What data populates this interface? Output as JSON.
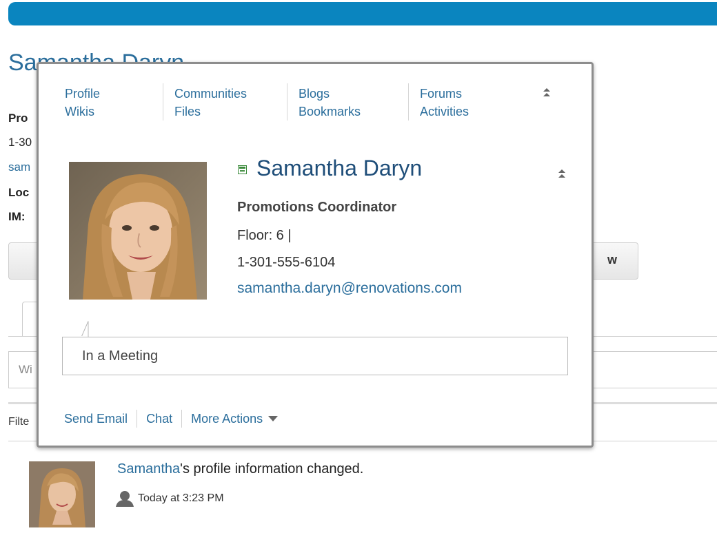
{
  "background": {
    "name_heading": "Samantha Daryn",
    "contact_lines": [
      {
        "text": "Pro",
        "style": "bold"
      },
      {
        "text": "1-30",
        "style": "plain"
      },
      {
        "text": "sam",
        "style": "link"
      },
      {
        "text": "Loc",
        "style": "bold"
      },
      {
        "text": "IM:",
        "style": "bold"
      }
    ],
    "button_fragment": "w",
    "status_input_placeholder": "Wi",
    "filter_label": "Filte",
    "activity": {
      "user_link": "Samantha",
      "message": "'s profile information changed.",
      "timestamp": "Today at 3:23 PM"
    }
  },
  "card": {
    "nav_columns": [
      [
        "Profile",
        "Wikis"
      ],
      [
        "Communities",
        "Files"
      ],
      [
        "Blogs",
        "Bookmarks"
      ],
      [
        "Forums",
        "Activities"
      ]
    ],
    "name": "Samantha Daryn",
    "title": "Promotions Coordinator",
    "floor": "Floor: 6  |",
    "phone": "1-301-555-6104",
    "email": "samantha.daryn@renovations.com",
    "status": "In a Meeting",
    "actions": {
      "send_email": "Send Email",
      "chat": "Chat",
      "more_actions": "More Actions"
    }
  },
  "icons": [
    "collapse-icon",
    "presence-icon",
    "chevron-down-icon",
    "person-icon"
  ],
  "colors": {
    "banner": "#0a85bf",
    "link": "#2b6e9c",
    "name": "#1f4e79",
    "card_border": "#8d8d8d"
  }
}
